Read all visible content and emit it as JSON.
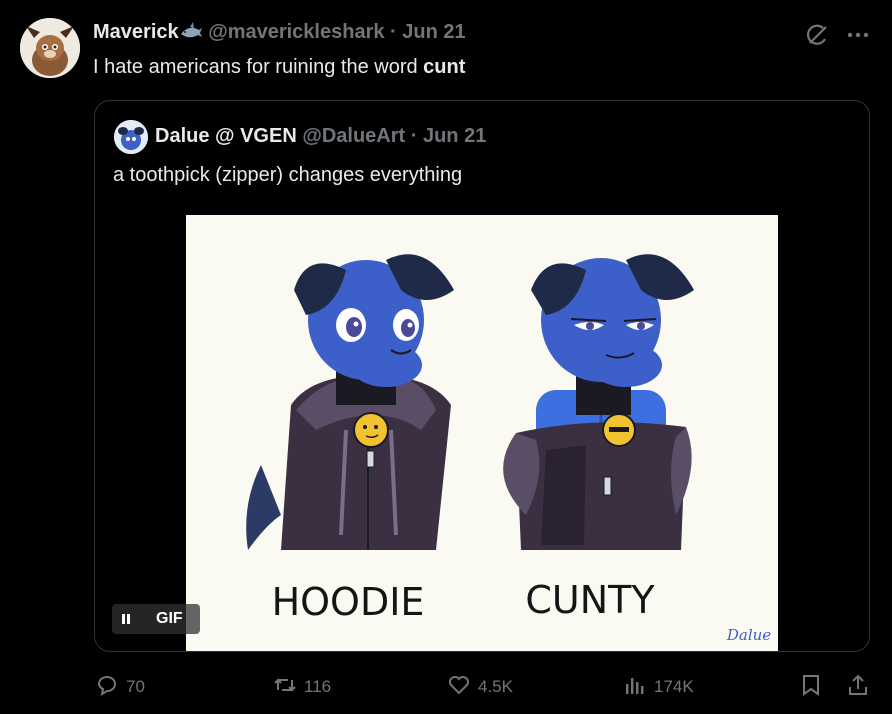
{
  "tweet": {
    "author": {
      "display_name": "Maverick",
      "handle": "@maverickleshark",
      "date": "Jun 21"
    },
    "text_prefix": "I hate americans for ruining the word ",
    "text_bold": "cunt"
  },
  "quote": {
    "author": {
      "display_name": "Dalue @ VGEN",
      "handle": "@DalueArt",
      "date": "Jun 21"
    },
    "text": "a toothpick (zipper) changes everything",
    "media": {
      "type": "GIF",
      "badge": "GIF",
      "caption_left": "HOODIE",
      "caption_right": "CUNTY",
      "signature": "Dalue"
    }
  },
  "actions": {
    "replies": "70",
    "reposts": "116",
    "likes": "4.5K",
    "views": "174K"
  },
  "icons": {
    "grok": "grok-icon",
    "more": "more-icon",
    "reply": "reply-icon",
    "repost": "repost-icon",
    "like": "heart-icon",
    "views": "views-icon",
    "bookmark": "bookmark-icon",
    "share": "share-icon"
  },
  "colors": {
    "background": "#000000",
    "text": "#e7e9ea",
    "muted": "#71767b",
    "border": "#2f3336",
    "character_blue": "#3d5fc9"
  }
}
